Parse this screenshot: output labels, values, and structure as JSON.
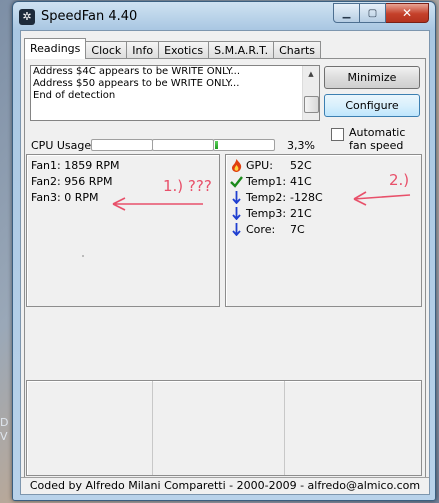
{
  "window": {
    "title": "SpeedFan 4.40"
  },
  "desktop": {
    "side_text": "D V"
  },
  "tabs": [
    "Readings",
    "Clock",
    "Info",
    "Exotics",
    "S.M.A.R.T.",
    "Charts"
  ],
  "active_tab": "Readings",
  "log": {
    "lines": [
      "Address $4C appears to be WRITE ONLY...",
      "Address $50 appears to be WRITE ONLY...",
      "End of detection"
    ]
  },
  "buttons": {
    "minimize": "Minimize",
    "configure": "Configure"
  },
  "auto_fan": {
    "label": "Automatic fan speed",
    "checked": false
  },
  "cpu": {
    "label": "CPU Usage",
    "value": "3,3%",
    "core_levels": [
      0,
      0,
      0.033
    ]
  },
  "fans": [
    "Fan1: 1859 RPM",
    "Fan2: 956 RPM",
    "Fan3: 0 RPM"
  ],
  "temps": [
    {
      "name": "GPU:",
      "value": "52C",
      "icon": "flame-icon"
    },
    {
      "name": "Temp1:",
      "value": "41C",
      "icon": "checkmark-icon"
    },
    {
      "name": "Temp2:",
      "value": "-128C",
      "icon": "down-arrow-icon"
    },
    {
      "name": "Temp3:",
      "value": "21C",
      "icon": "down-arrow-icon"
    },
    {
      "name": "Core:",
      "value": "7C",
      "icon": "down-arrow-icon"
    }
  ],
  "annotations": {
    "left": "1.) ???",
    "right": "2.)"
  },
  "status_bar": "Coded by Alfredo Milani Comparetti - 2000-2009 - alfredo@almico.com",
  "colors": {
    "annotation": "#e8506a",
    "check": "#1a8a1a",
    "arrow": "#1f3fd0",
    "flame": "#e04010"
  }
}
